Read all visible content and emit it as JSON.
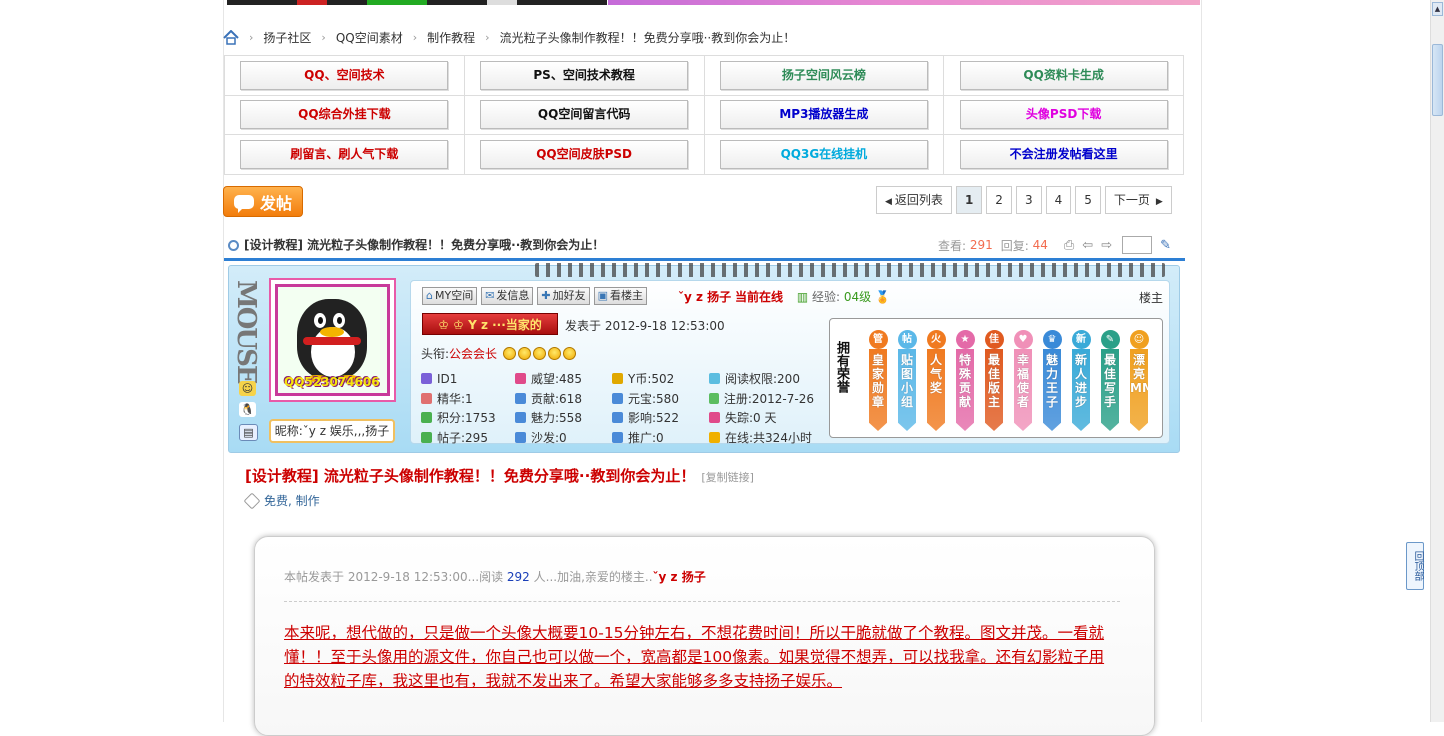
{
  "breadcrumb": {
    "items": [
      "扬子社区",
      "QQ空间素材",
      "制作教程",
      "流光粒子头像制作教程！！免费分享哦··教到你会为止！"
    ]
  },
  "link_grid": [
    [
      {
        "label": "QQ、空间技术",
        "color": "#cc0000"
      },
      {
        "label": "PS、空间技术教程",
        "color": "#111111"
      },
      {
        "label": "扬子空间风云榜",
        "color": "#2e8b57"
      },
      {
        "label": "QQ资料卡生成",
        "color": "#2e8b57"
      }
    ],
    [
      {
        "label": "QQ综合外挂下载",
        "color": "#cc0000"
      },
      {
        "label": "QQ空间留言代码",
        "color": "#111111"
      },
      {
        "label": "MP3播放器生成",
        "color": "#0000cc"
      },
      {
        "label": "头像PSD下载",
        "color": "#e000e0"
      }
    ],
    [
      {
        "label": "刷留言、刷人气下载",
        "color": "#cc0000"
      },
      {
        "label": "QQ空间皮肤PSD",
        "color": "#cc0000"
      },
      {
        "label": "QQ3G在线挂机",
        "color": "#00aadd"
      },
      {
        "label": "不会注册发帖看这里",
        "color": "#0000cc"
      }
    ]
  ],
  "post_button": {
    "label": "发帖"
  },
  "pager": {
    "back": "返回列表",
    "pages": [
      "1",
      "2",
      "3",
      "4",
      "5"
    ],
    "current": "1",
    "next": "下一页"
  },
  "thread": {
    "title": "[设计教程] 流光粒子头像制作教程！！免费分享哦··教到你会为止！",
    "views_label": "查看:",
    "views": "291",
    "replies_label": "回复:",
    "replies": "44"
  },
  "author": {
    "side_text": "MOUSE",
    "qq_number": "QQ523074606",
    "nickname": "昵称:ˇy z 娱乐,,,扬子",
    "buttons": [
      "MY空间",
      "发信息",
      "加好友",
      "看楼主"
    ],
    "username": "ˇy z 扬子",
    "online": "当前在线",
    "exp_label": "经验:",
    "level": "04级",
    "floor": "楼主",
    "rank_badge": "♔ ♔ Y z ···当家的",
    "post_time": "发表于 2012-9-18 12:53:00",
    "title_label": "头衔:",
    "title_value": "公会会长",
    "stats": [
      {
        "label": "ID1",
        "color": "#7a60d8"
      },
      {
        "label": "威望:485",
        "color": "#e04a8a"
      },
      {
        "label": "Y币:502",
        "color": "#e0a800"
      },
      {
        "label": "阅读权限:200",
        "color": "#5bbde0"
      },
      {
        "label": "精华:1",
        "color": "#e07070"
      },
      {
        "label": "贡献:618",
        "color": "#4a8ad8"
      },
      {
        "label": "元宝:580",
        "color": "#4a8ad8"
      },
      {
        "label": "注册:2012-7-26",
        "color": "#5bbd60"
      },
      {
        "label": "积分:1753",
        "color": "#4ab050"
      },
      {
        "label": "魅力:558",
        "color": "#4a8ad8"
      },
      {
        "label": "影响:522",
        "color": "#4a8ad8"
      },
      {
        "label": "失踪:0 天",
        "color": "#e04a8a"
      },
      {
        "label": "帖子:295",
        "color": "#4ab050"
      },
      {
        "label": "沙发:0",
        "color": "#4a8ad8"
      },
      {
        "label": "推广:0",
        "color": "#4a8ad8"
      },
      {
        "label": "在线:共324小时",
        "color": "#f0b000"
      }
    ],
    "medal_label": "拥有荣誉",
    "medals": [
      {
        "coin": "管",
        "text": "皇家勋章",
        "color": "#f07a20"
      },
      {
        "coin": "帖",
        "text": "贴图小组",
        "color": "#5bb8e8"
      },
      {
        "coin": "火",
        "text": "人气奖",
        "color": "#f07a20"
      },
      {
        "coin": "★",
        "text": "特殊贡献",
        "color": "#e46aa8"
      },
      {
        "coin": "佳",
        "text": "最佳版主",
        "color": "#e05a20"
      },
      {
        "coin": "♥",
        "text": "幸福使者",
        "color": "#f090b8"
      },
      {
        "coin": "♛",
        "text": "魅力王子",
        "color": "#3a8ad8"
      },
      {
        "coin": "新",
        "text": "新人进步",
        "color": "#3aaad8"
      },
      {
        "coin": "✎",
        "text": "最佳写手",
        "color": "#2aa088"
      },
      {
        "coin": "☺",
        "text": "漂亮MM",
        "color": "#f0a020"
      }
    ]
  },
  "post": {
    "title": "[设计教程] 流光粒子头像制作教程！！免费分享哦··教到你会为止！",
    "copy_link": "[复制链接]",
    "tags": "免费, 制作",
    "notice_prefix": "本帖发表于 2012-9-18 12:53:00...阅读",
    "notice_count": "292",
    "notice_suffix": "人...加油,亲爱的楼主..",
    "notice_user": "ˇy z 扬子",
    "body": "本来呢，想代做的，只是做一个头像大概要10-15分钟左右，不想花费时间！所以干脆就做了个教程。图文并茂。一看就懂！！至于头像用的源文件，你自己也可以做一个，宽高都是100像素。如果觉得不想弄，可以找我拿。还有幻影粒子用的特效粒子库，我这里也有，我就不发出来了。希望大家能够多多支持扬子娱乐。"
  },
  "back_to_top": "回顶部"
}
